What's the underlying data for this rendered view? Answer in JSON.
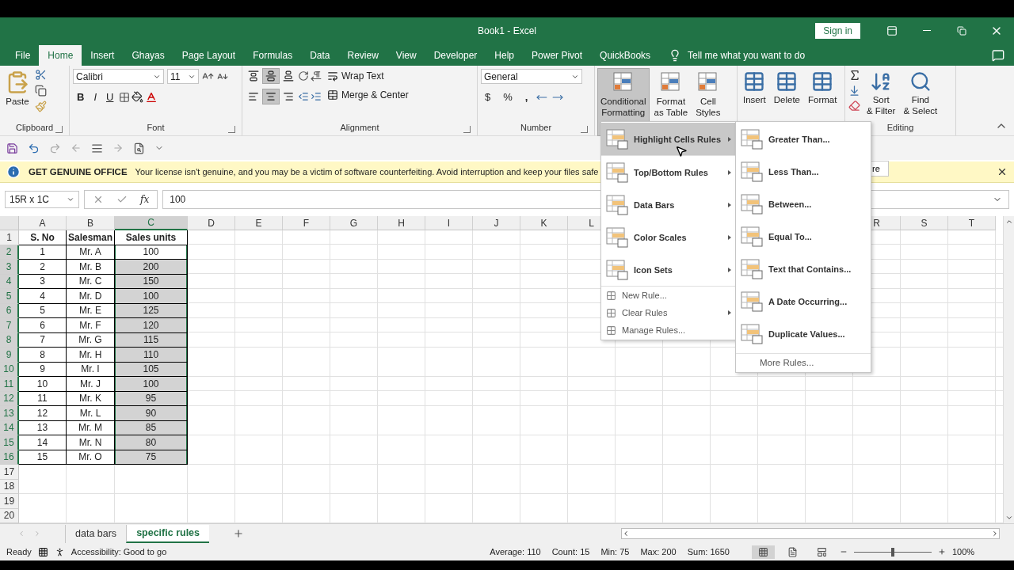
{
  "window": {
    "title": "Book1  -  Excel",
    "sign_in": "Sign in"
  },
  "tabs": [
    {
      "label": "File",
      "selected": false
    },
    {
      "label": "Home",
      "selected": true
    },
    {
      "label": "Insert",
      "selected": false
    },
    {
      "label": "Ghayas",
      "selected": false
    },
    {
      "label": "Page Layout",
      "selected": false
    },
    {
      "label": "Formulas",
      "selected": false
    },
    {
      "label": "Data",
      "selected": false
    },
    {
      "label": "Review",
      "selected": false
    },
    {
      "label": "View",
      "selected": false
    },
    {
      "label": "Developer",
      "selected": false
    },
    {
      "label": "Help",
      "selected": false
    },
    {
      "label": "Power Pivot",
      "selected": false
    },
    {
      "label": "QuickBooks",
      "selected": false
    }
  ],
  "tell_me": {
    "placeholder": "Tell me what you want to do"
  },
  "ribbon": {
    "clipboard": {
      "paste": "Paste",
      "label": "Clipboard"
    },
    "font": {
      "name": "Calibri",
      "size": "11",
      "bold": "B",
      "italic": "I",
      "underline": "U",
      "label": "Font"
    },
    "alignment": {
      "buttons": [
        {
          "kind": "top",
          "selected": false
        },
        {
          "kind": "middle",
          "selected": true
        },
        {
          "kind": "bottom",
          "selected": false
        },
        {
          "kind": "left",
          "selected": false
        },
        {
          "kind": "center",
          "selected": true
        },
        {
          "kind": "right",
          "selected": false
        }
      ],
      "wrap": "Wrap Text",
      "merge": "Merge & Center",
      "label": "Alignment"
    },
    "number": {
      "format": "General",
      "currency": "$",
      "percent": "%",
      "comma": ",",
      "label": "Number"
    },
    "styles": [
      {
        "label": "Conditional Formatting",
        "selected": true
      },
      {
        "label": "Format as Table",
        "selected": false
      },
      {
        "label": "Cell Styles",
        "selected": false
      }
    ],
    "cells": [
      "Insert",
      "Delete",
      "Format"
    ],
    "editing": {
      "buttons": [
        "Sort & Filter",
        "Find & Select"
      ],
      "label": "Editing"
    }
  },
  "warning": {
    "title": "GET GENUINE OFFICE",
    "message": "Your license isn't genuine, and you may be a victim of software counterfeiting. Avoid interruption and keep your files safe",
    "button": "re"
  },
  "formula_bar": {
    "name_box": "15R x 1C",
    "fx": "fx",
    "value": "100"
  },
  "sheet": {
    "columns": [
      {
        "label": "A",
        "selected": false
      },
      {
        "label": "B",
        "selected": false
      },
      {
        "label": "C",
        "selected": true
      },
      {
        "label": "D",
        "selected": false
      },
      {
        "label": "E",
        "selected": false
      },
      {
        "label": "F",
        "selected": false
      },
      {
        "label": "G",
        "selected": false
      },
      {
        "label": "H",
        "selected": false
      },
      {
        "label": "I",
        "selected": false
      },
      {
        "label": "J",
        "selected": false
      },
      {
        "label": "K",
        "selected": false
      },
      {
        "label": "L",
        "selected": false
      },
      {
        "label": "R",
        "selected": false
      },
      {
        "label": "S",
        "selected": false
      },
      {
        "label": "T",
        "selected": false
      }
    ],
    "rows": [
      {
        "number": "1",
        "selected": false,
        "cells": [
          "S. No",
          "Salesman",
          "Sales units"
        ]
      },
      {
        "number": "2",
        "selected": true,
        "active": true,
        "cells": [
          "1",
          "Mr. A",
          "100"
        ]
      },
      {
        "number": "3",
        "selected": true,
        "active": false,
        "cells": [
          "2",
          "Mr. B",
          "200"
        ]
      },
      {
        "number": "4",
        "selected": true,
        "active": false,
        "cells": [
          "3",
          "Mr. C",
          "150"
        ]
      },
      {
        "number": "5",
        "selected": true,
        "active": false,
        "cells": [
          "4",
          "Mr. D",
          "100"
        ]
      },
      {
        "number": "6",
        "selected": true,
        "active": false,
        "cells": [
          "5",
          "Mr. E",
          "125"
        ]
      },
      {
        "number": "7",
        "selected": true,
        "active": false,
        "cells": [
          "6",
          "Mr. F",
          "120"
        ]
      },
      {
        "number": "8",
        "selected": true,
        "active": false,
        "cells": [
          "7",
          "Mr. G",
          "115"
        ]
      },
      {
        "number": "9",
        "selected": true,
        "active": false,
        "cells": [
          "8",
          "Mr. H",
          "110"
        ]
      },
      {
        "number": "10",
        "selected": true,
        "active": false,
        "cells": [
          "9",
          "Mr. I",
          "105"
        ]
      },
      {
        "number": "11",
        "selected": true,
        "active": false,
        "cells": [
          "10",
          "Mr. J",
          "100"
        ]
      },
      {
        "number": "12",
        "selected": true,
        "active": false,
        "cells": [
          "11",
          "Mr. K",
          "95"
        ]
      },
      {
        "number": "13",
        "selected": true,
        "active": false,
        "cells": [
          "12",
          "Mr. L",
          "90"
        ]
      },
      {
        "number": "14",
        "selected": true,
        "active": false,
        "cells": [
          "13",
          "Mr. M",
          "85"
        ]
      },
      {
        "number": "15",
        "selected": true,
        "active": false,
        "cells": [
          "14",
          "Mr. N",
          "80"
        ]
      },
      {
        "number": "16",
        "selected": true,
        "active": false,
        "cells": [
          "15",
          "Mr. O",
          "75"
        ]
      },
      {
        "number": "17",
        "selected": false,
        "cells": []
      },
      {
        "number": "18",
        "selected": false,
        "cells": []
      },
      {
        "number": "19",
        "selected": false,
        "cells": []
      },
      {
        "number": "20",
        "selected": false,
        "cells": []
      }
    ]
  },
  "cf_menu": [
    {
      "label": "Highlight Cells Rules",
      "kind": "large",
      "selected": true
    },
    {
      "label": "Top/Bottom Rules",
      "kind": "large",
      "selected": false
    },
    {
      "label": "Data Bars",
      "kind": "large",
      "selected": false
    },
    {
      "label": "Color Scales",
      "kind": "large",
      "selected": false
    },
    {
      "label": "Icon Sets",
      "kind": "large",
      "selected": false
    },
    {
      "label": "New Rule...",
      "kind": "small",
      "submenu": false
    },
    {
      "label": "Clear Rules",
      "kind": "small",
      "submenu": true
    },
    {
      "label": "Manage Rules...",
      "kind": "small",
      "submenu": false
    }
  ],
  "submenu": [
    {
      "label": "Greater Than...",
      "kind": "large"
    },
    {
      "label": "Less Than...",
      "kind": "large"
    },
    {
      "label": "Between...",
      "kind": "large"
    },
    {
      "label": "Equal To...",
      "kind": "large"
    },
    {
      "label": "Text that Contains...",
      "kind": "large"
    },
    {
      "label": "A Date Occurring...",
      "kind": "large"
    },
    {
      "label": "Duplicate Values...",
      "kind": "large"
    },
    {
      "label": "More Rules...",
      "kind": "more"
    }
  ],
  "sheet_tabs": [
    {
      "label": "data bars",
      "selected": false
    },
    {
      "label": "specific rules",
      "selected": true
    }
  ],
  "status_bar": {
    "ready": "Ready",
    "accessibility": "Accessibility: Good to go",
    "stats": [
      "Average: 110",
      "Count: 15",
      "Min: 75",
      "Max: 200",
      "Sum: 1650"
    ],
    "views": [
      {
        "kind": "normal",
        "selected": true
      },
      {
        "kind": "page_layout",
        "selected": false
      },
      {
        "kind": "page_break",
        "selected": false
      }
    ],
    "zoom": {
      "level": 0.5,
      "reading": "100%"
    }
  }
}
